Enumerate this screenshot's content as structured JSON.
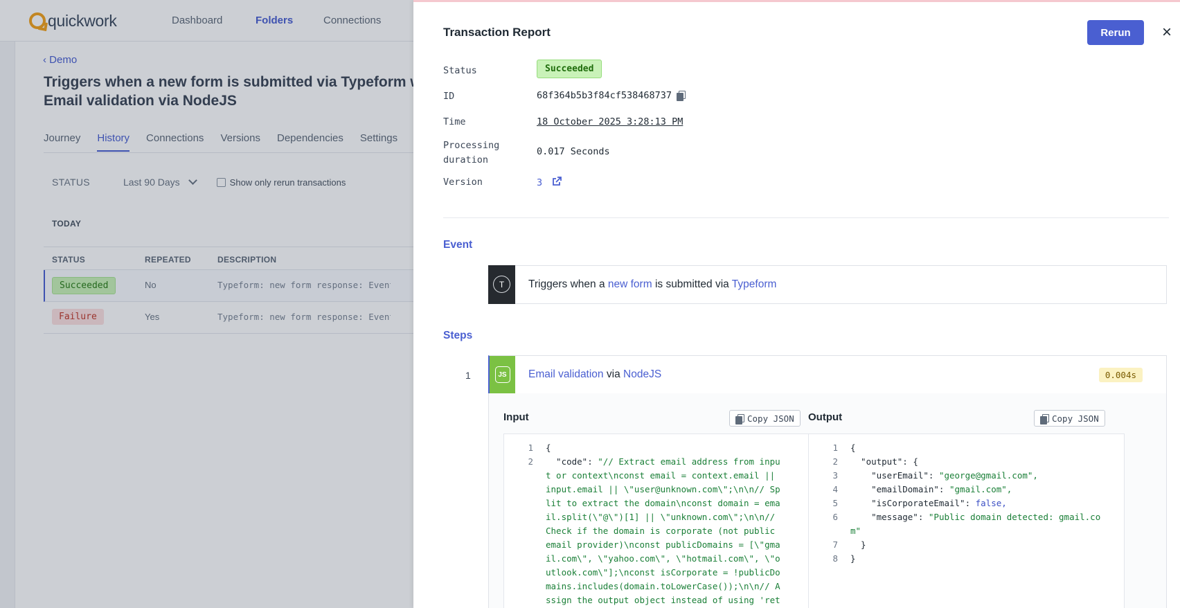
{
  "app": {
    "logo_text": "quickwork",
    "nav": [
      "Dashboard",
      "Folders",
      "Connections"
    ],
    "breadcrumb": "Demo",
    "title_line1": "Triggers when a new form is submitted via Typeform w",
    "title_line2": "Email validation via NodeJS",
    "tabs": [
      "Journey",
      "History",
      "Connections",
      "Versions",
      "Dependencies",
      "Settings"
    ],
    "filter": {
      "status_label": "STATUS",
      "range": "Last 90 Days",
      "checkbox_label": "Show only rerun transactions"
    },
    "group_label": "TODAY",
    "columns": [
      "STATUS",
      "REPEATED",
      "DESCRIPTION"
    ],
    "rows": [
      {
        "status": "Succeeded",
        "repeated": "No",
        "description": "Typeform: new form response: Event_i"
      },
      {
        "status": "Failure",
        "repeated": "Yes",
        "description": "Typeform: new form response: Event_i"
      }
    ]
  },
  "report": {
    "title": "Transaction Report",
    "rerun_label": "Rerun",
    "close_symbol": "×",
    "labels": {
      "status": "Status",
      "id": "ID",
      "time": "Time",
      "duration_1": "Processing",
      "duration_2": "duration",
      "version": "Version"
    },
    "status": "Succeeded",
    "id": "68f364b5b3f84cf538468737",
    "time": "18 October 2025 3:28:13 PM",
    "duration": "0.017 Seconds",
    "version": "3",
    "event_heading": "Event",
    "event": {
      "icon_letter": "T",
      "prefix": "Triggers when a",
      "link1": "new form",
      "middle": "is submitted via",
      "link2": "Typeform"
    },
    "steps_heading": "Steps",
    "step": {
      "number": "1",
      "icon_text": "JS",
      "link1": "Email validation",
      "middle": "via",
      "link2": "NodeJS",
      "time": "0.004s"
    },
    "input_heading": "Input",
    "output_heading": "Output",
    "copy_json_label": "Copy JSON",
    "input_lines": [
      {
        "num": "1",
        "text": "{"
      },
      {
        "num": "2",
        "key": "  \"code\": ",
        "text": "\"// Extract email address from inpu"
      },
      {
        "num": "",
        "text": "t or context\\nconst email = context.email ||"
      },
      {
        "num": "",
        "text": "input.email || \\\"user@unknown.com\\\";\\n\\n// Sp"
      },
      {
        "num": "",
        "text": "lit to extract the domain\\nconst domain = ema"
      },
      {
        "num": "",
        "text": "il.split(\\\"@\\\")[1] || \\\"unknown.com\\\";\\n\\n//"
      },
      {
        "num": "",
        "text": "Check if the domain is corporate (not public"
      },
      {
        "num": "",
        "text": "email provider)\\nconst publicDomains = [\\\"gma"
      },
      {
        "num": "",
        "text": "il.com\\\", \\\"yahoo.com\\\", \\\"hotmail.com\\\", \\\"o"
      },
      {
        "num": "",
        "text": "utlook.com\\\"];\\nconst isCorporate = !publicDo"
      },
      {
        "num": "",
        "text": "mains.includes(domain.toLowerCase());\\n\\n// A"
      },
      {
        "num": "",
        "text": "ssign the output object instead of using 'ret"
      }
    ],
    "output_lines": [
      {
        "num": "1",
        "text": "{"
      },
      {
        "num": "2",
        "key": "  \"output\": ",
        "text": "{"
      },
      {
        "num": "3",
        "key": "    \"userEmail\": ",
        "text": "\"george@gmail.com\",",
        "type": "str"
      },
      {
        "num": "4",
        "key": "    \"emailDomain\": ",
        "text": "\"gmail.com\",",
        "type": "str"
      },
      {
        "num": "5",
        "key": "    \"isCorporateEmail\": ",
        "text": "false,",
        "type": "kw"
      },
      {
        "num": "6",
        "key": "    \"message\": ",
        "text": "\"Public domain detected: gmail.co",
        "type": "str"
      },
      {
        "num": "",
        "text": "m\"",
        "type": "str"
      },
      {
        "num": "7",
        "text": "  }"
      },
      {
        "num": "8",
        "text": "}"
      }
    ]
  }
}
